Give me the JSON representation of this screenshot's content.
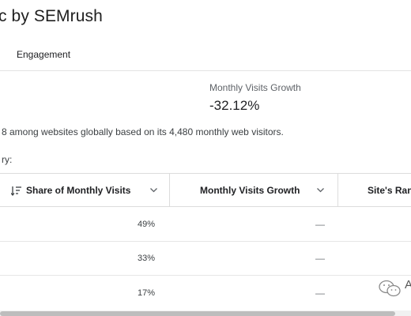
{
  "header": {
    "title": "c by SEMrush"
  },
  "tabs": [
    {
      "label": "Engagement"
    }
  ],
  "metrics": {
    "growth_label": "Monthly Visits Growth",
    "growth_value": "-32.12%"
  },
  "rank_text": "8 among websites globally based on its 4,480 monthly web visitors.",
  "section_label": "ry:",
  "table": {
    "columns": [
      {
        "label": "Share of Monthly Visits"
      },
      {
        "label": "Monthly Visits Growth"
      },
      {
        "label": "Site's Rank"
      }
    ],
    "rows": [
      {
        "share": "49%",
        "growth": "—"
      },
      {
        "share": "33%",
        "growth": "—"
      },
      {
        "share": "17%",
        "growth": "—"
      }
    ]
  },
  "watermark": {
    "text": "A"
  },
  "icons": {
    "sort": "sort-descending-icon",
    "chevron": "chevron-down-icon",
    "watermark": "wechat-icon"
  }
}
